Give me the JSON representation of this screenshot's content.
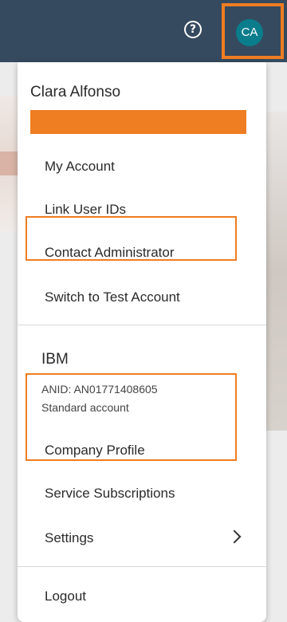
{
  "header": {
    "help_icon_glyph": "?",
    "avatar_initials": "CA"
  },
  "menu": {
    "user_name": "Clara Alfonso",
    "items": [
      {
        "label": "My Account"
      },
      {
        "label": "Link User IDs"
      },
      {
        "label": "Contact Administrator"
      },
      {
        "label": "Switch to Test Account"
      }
    ],
    "company": {
      "name": "IBM",
      "anid": "ANID: AN01771408605",
      "account_type": "Standard account",
      "items": [
        {
          "label": "Company Profile"
        },
        {
          "label": "Service Subscriptions"
        },
        {
          "label": "Settings"
        }
      ]
    },
    "logout_label": "Logout"
  },
  "colors": {
    "header_bg": "#354a5f",
    "avatar_bg": "#0a7d8c",
    "highlight": "#ef7d22"
  }
}
